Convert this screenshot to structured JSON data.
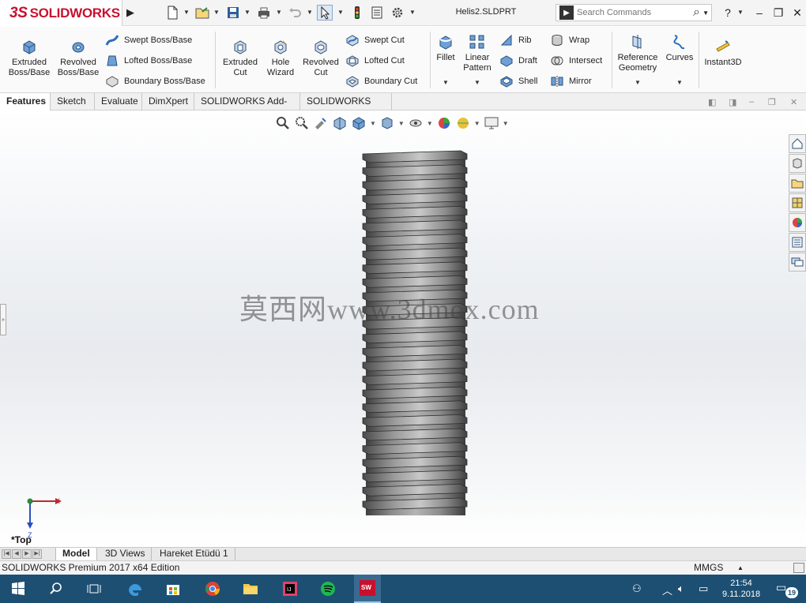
{
  "app": {
    "brand": "SOLIDWORKS",
    "brand_prefix": "3S",
    "document_title": "Helis2.SLDPRT"
  },
  "search": {
    "placeholder": "Search Commands"
  },
  "ribbon": {
    "extruded_boss": "Extruded Boss/Base",
    "revolved_boss": "Revolved Boss/Base",
    "swept_boss": "Swept Boss/Base",
    "lofted_boss": "Lofted Boss/Base",
    "boundary_boss": "Boundary Boss/Base",
    "extruded_cut": "Extruded Cut",
    "hole_wizard": "Hole Wizard",
    "revolved_cut": "Revolved Cut",
    "swept_cut": "Swept Cut",
    "lofted_cut": "Lofted Cut",
    "boundary_cut": "Boundary Cut",
    "fillet": "Fillet",
    "linear_pattern": "Linear Pattern",
    "rib": "Rib",
    "draft": "Draft",
    "shell": "Shell",
    "wrap": "Wrap",
    "intersect": "Intersect",
    "mirror": "Mirror",
    "reference_geometry": "Reference Geometry",
    "curves": "Curves",
    "instant3d": "Instant3D"
  },
  "command_tabs": [
    "Features",
    "Sketch",
    "Evaluate",
    "DimXpert",
    "SOLIDWORKS Add-Ins",
    "SOLIDWORKS MBD"
  ],
  "viewport": {
    "view_name": "*Top",
    "watermark": "莫西网www.3dmox.com",
    "triad_x": "X",
    "triad_z": "Z"
  },
  "bottom_tabs": [
    "Model",
    "3D Views",
    "Hareket Etüdü 1"
  ],
  "status": {
    "edition": "SOLIDWORKS Premium 2017 x64 Edition",
    "units": "MMGS"
  },
  "taskbar": {
    "time": "21:54",
    "date": "9.11.2018",
    "notification_count": "19"
  },
  "colors": {
    "brand_red": "#c8102e",
    "taskbar": "#1d4f73",
    "thread": "#6e6e6e"
  }
}
